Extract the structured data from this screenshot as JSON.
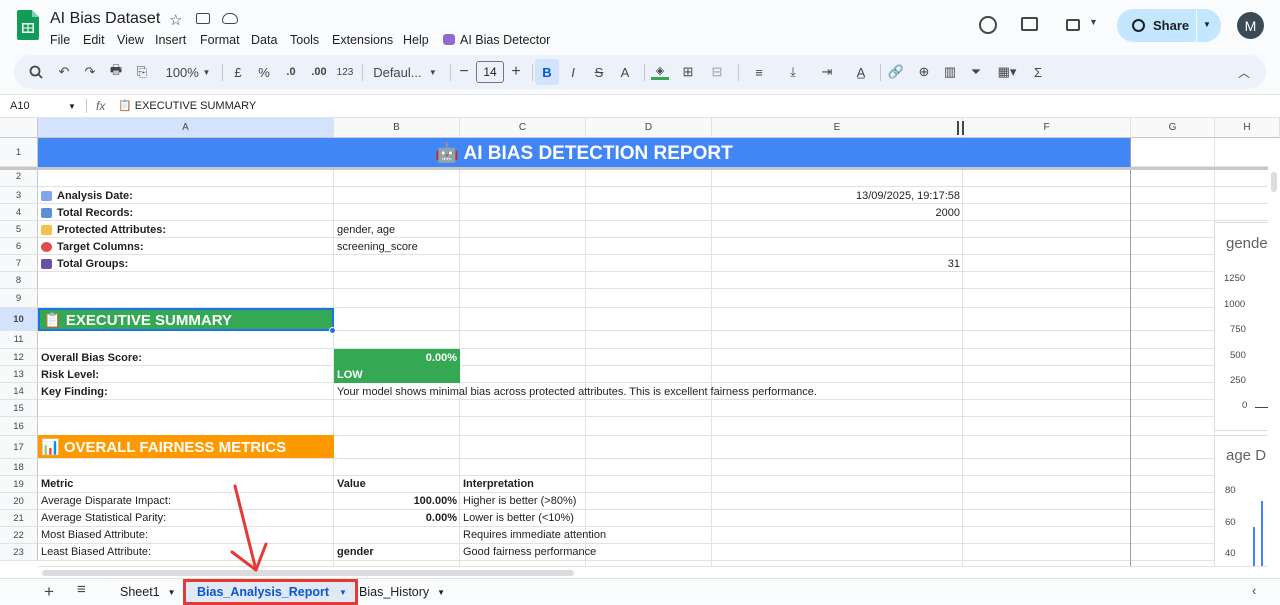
{
  "app": {
    "doc_title": "AI Bias Dataset",
    "menu": [
      "File",
      "Edit",
      "View",
      "Insert",
      "Format",
      "Data",
      "Tools",
      "Extensions",
      "Help"
    ],
    "addon_label": "AI Bias Detector",
    "share_label": "Share",
    "avatar_letter": "M",
    "brand_green": "#0f9d58"
  },
  "toolbar": {
    "zoom": "100%",
    "currency": "£",
    "percent": "%",
    "dec_less": ".0",
    "dec_more": ".00",
    "format_123": "123",
    "font": "Defaul...",
    "font_size": "14",
    "bold": "B",
    "italic": "I",
    "strike": "S",
    "text_color": "A"
  },
  "formula_bar": {
    "cell_ref": "A10",
    "fx": "fx",
    "content": "📋 EXECUTIVE SUMMARY"
  },
  "columns": [
    "A",
    "B",
    "C",
    "D",
    "E",
    "F",
    "G",
    "H"
  ],
  "rows": [
    "1",
    "2",
    "3",
    "4",
    "5",
    "6",
    "7",
    "8",
    "9",
    "10",
    "11",
    "12",
    "13",
    "14",
    "15",
    "16",
    "17",
    "18",
    "19",
    "20",
    "21",
    "22",
    "23"
  ],
  "sheet": {
    "report_title": "🤖  AI BIAS DETECTION REPORT",
    "info": {
      "analysis_date_label": "Analysis Date:",
      "analysis_date_value": "13/09/2025, 19:17:58",
      "total_records_label": "Total Records:",
      "total_records_value": "2000",
      "protected_label": "Protected Attributes:",
      "protected_value": "gender, age",
      "target_label": "Target Columns:",
      "target_value": "screening_score",
      "groups_label": "Total Groups:",
      "groups_value": "31"
    },
    "exec_header": "📋 EXECUTIVE SUMMARY",
    "overall_bias_label": "Overall Bias Score:",
    "overall_bias_value": "0.00%",
    "risk_label": "Risk Level:",
    "risk_value": "LOW",
    "key_finding_label": "Key Finding:",
    "key_finding_value": "Your model shows minimal bias across protected attributes. This is excellent fairness performance.",
    "metrics_header": "📊 OVERALL FAIRNESS METRICS",
    "metrics_columns": [
      "Metric",
      "Value",
      "Interpretation"
    ],
    "metrics_rows": [
      [
        "Average Disparate Impact:",
        "100.00%",
        "Higher is better (>80%)"
      ],
      [
        "Average Statistical Parity:",
        "0.00%",
        "Lower is better (<10%)"
      ],
      [
        "Most Biased Attribute:",
        "",
        "Requires immediate attention"
      ],
      [
        "Least Biased Attribute:",
        "gender",
        "Good fairness performance"
      ]
    ],
    "colors": {
      "title_bg": "#4285f4",
      "exec_bg": "#34a853",
      "metrics_bg": "#ff9900"
    }
  },
  "charts": {
    "chart1_title": "gende",
    "chart1_ticks": [
      "1250",
      "1000",
      "750",
      "500",
      "250",
      "0"
    ],
    "chart2_title": "age D",
    "chart2_ticks": [
      "80",
      "60",
      "40"
    ]
  },
  "tabs": {
    "sheet1": "Sheet1",
    "report": "Bias_Analysis_Report",
    "history": "Bias_History"
  }
}
